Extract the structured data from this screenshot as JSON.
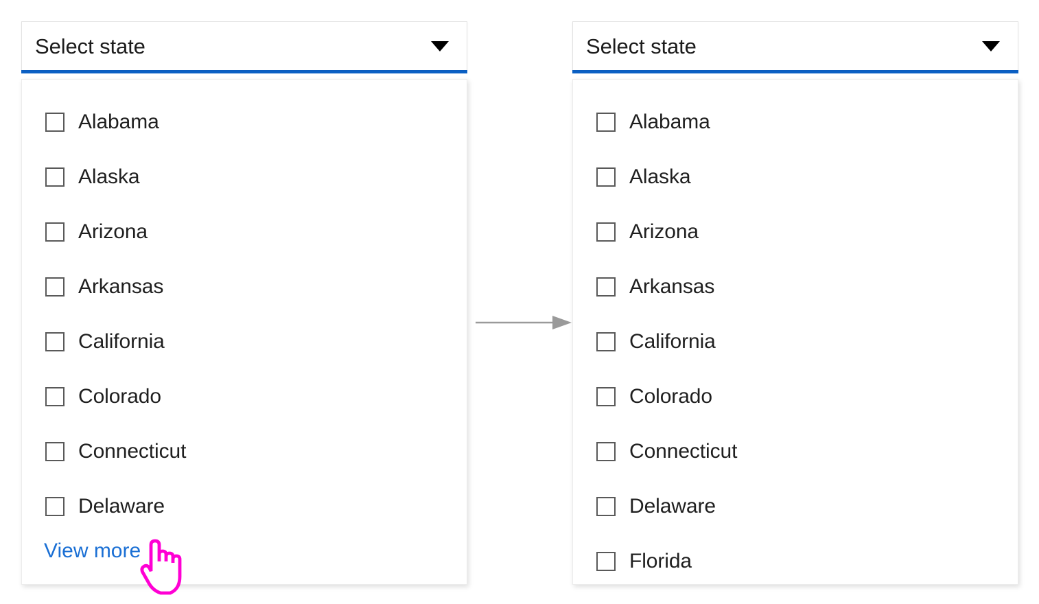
{
  "panels": [
    {
      "id": "before",
      "header": {
        "label": "Select state",
        "caret_icon": "chevron-down-icon",
        "underline_color": "#0b60c4"
      },
      "options": [
        {
          "label": "Alabama",
          "checked": false
        },
        {
          "label": "Alaska",
          "checked": false
        },
        {
          "label": "Arizona",
          "checked": false
        },
        {
          "label": "Arkansas",
          "checked": false
        },
        {
          "label": "California",
          "checked": false
        },
        {
          "label": "Colorado",
          "checked": false
        },
        {
          "label": "Connecticut",
          "checked": false
        },
        {
          "label": "Delaware",
          "checked": false
        }
      ],
      "view_more": {
        "label": "View more",
        "color": "#1a6fd4"
      }
    },
    {
      "id": "after",
      "header": {
        "label": "Select state",
        "caret_icon": "chevron-down-icon",
        "underline_color": "#0b60c4"
      },
      "options": [
        {
          "label": "Alabama",
          "checked": false
        },
        {
          "label": "Alaska",
          "checked": false
        },
        {
          "label": "Arizona",
          "checked": false
        },
        {
          "label": "Arkansas",
          "checked": false
        },
        {
          "label": "California",
          "checked": false
        },
        {
          "label": "Colorado",
          "checked": false
        },
        {
          "label": "Connecticut",
          "checked": false
        },
        {
          "label": "Delaware",
          "checked": false
        },
        {
          "label": "Florida",
          "checked": false
        }
      ],
      "view_more": null
    }
  ],
  "flow": {
    "arrow_icon": "right-arrow-icon",
    "color": "#9a9a9a"
  },
  "cursor": {
    "icon": "pointing-hand-cursor",
    "outline_color": "#ff00d4",
    "fill_color": "#ffffff"
  },
  "colors": {
    "accent_blue": "#0b60c4",
    "link_blue": "#1a6fd4",
    "text": "#1f1f1f",
    "checkbox_border": "#595959",
    "panel_border": "#ececec",
    "background": "#ffffff"
  }
}
